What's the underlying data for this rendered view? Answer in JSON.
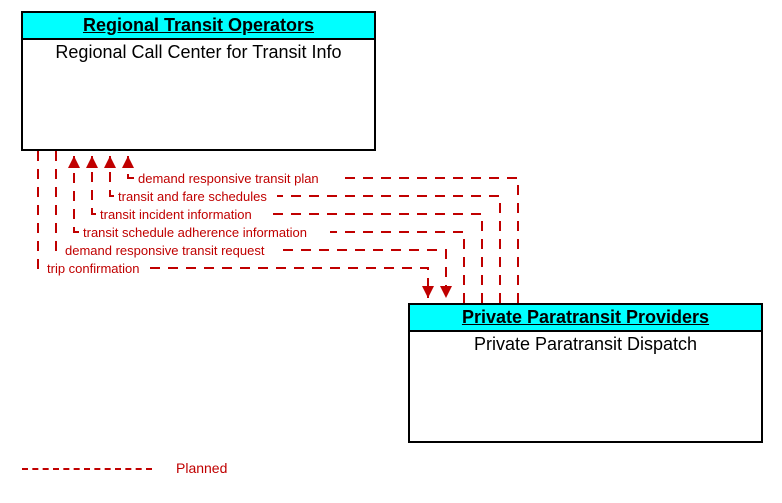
{
  "box1": {
    "header": "Regional Transit Operators",
    "sub": "Regional Call Center for Transit Info"
  },
  "box2": {
    "header": "Private Paratransit Providers",
    "sub": "Private Paratransit Dispatch"
  },
  "flows": {
    "f1": "demand responsive transit plan",
    "f2": "transit and fare schedules",
    "f3": "transit incident information",
    "f4": "transit schedule adherence information",
    "f5": "demand responsive transit request",
    "f6": "trip confirmation"
  },
  "legend": "Planned"
}
